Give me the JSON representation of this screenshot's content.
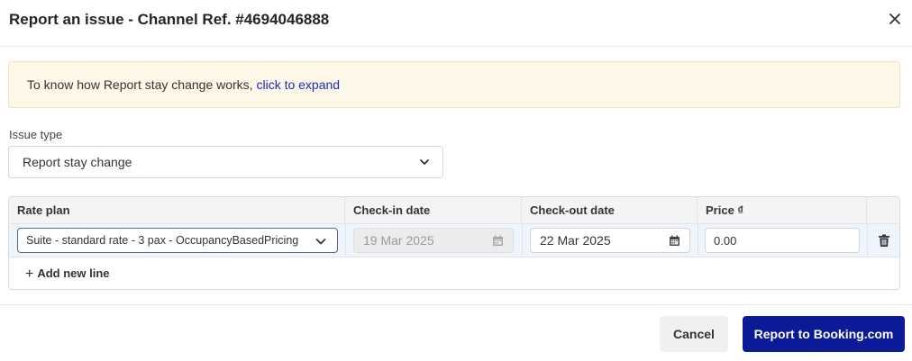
{
  "dialog": {
    "title": "Report an issue - Channel Ref. #4694046888"
  },
  "info": {
    "text": "To know how Report stay change works,",
    "link": "click to expand"
  },
  "issue_type": {
    "label": "Issue type",
    "value": "Report stay change"
  },
  "table": {
    "headers": {
      "rate_plan": "Rate plan",
      "check_in": "Check-in date",
      "check_out": "Check-out date",
      "price": "Price ₫"
    },
    "rows": [
      {
        "rate_plan": "Suite - standard rate - 3 pax - OccupancyBasedPricing",
        "check_in": "19 Mar 2025",
        "check_out": "22 Mar 2025",
        "price": "0.00"
      }
    ],
    "add_line_label": "Add new line"
  },
  "buttons": {
    "cancel": "Cancel",
    "report": "Report to Booking.com"
  },
  "colors": {
    "primary": "#0b1a96",
    "link": "#1a2bbd",
    "info_bg": "#fdf7e8",
    "row_selected_bg": "#eef5fd"
  },
  "icons": {
    "close": "close-icon",
    "dropdown": "chevron-down-icon",
    "calendar": "calendar-icon",
    "delete": "trash-icon",
    "add": "plus-icon"
  }
}
